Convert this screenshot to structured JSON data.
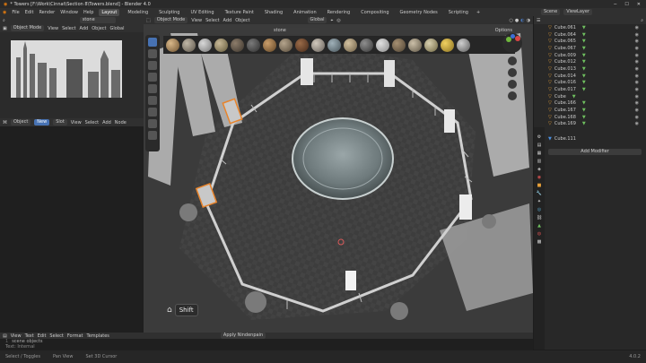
{
  "window": {
    "title": "* Towers [F:\\Work\\Cinnat\\Section 8\\Towers.blend] - Blender 4.0"
  },
  "menu": [
    "File",
    "Edit",
    "Render",
    "Window",
    "Help"
  ],
  "workspaces": [
    "Layout",
    "Modeling",
    "Sculpting",
    "UV Editing",
    "Texture Paint",
    "Shading",
    "Animation",
    "Rendering",
    "Compositing",
    "Geometry Nodes",
    "Scripting"
  ],
  "topright": {
    "scene": "Scene",
    "viewlayer": "ViewLayer"
  },
  "image_editor": {
    "mode": "Object Mode",
    "view": "View",
    "select": "Select",
    "add": "Add",
    "object": "Object",
    "orientation": "Global",
    "search": "stone"
  },
  "node_editor": {
    "object": "Object",
    "view": "View",
    "select": "Select",
    "add": "Add",
    "node": "Node",
    "new": "New",
    "slot": "Slot"
  },
  "viewport": {
    "mode": "Object Mode",
    "view": "View",
    "select": "Select",
    "add": "Add",
    "object": "Object",
    "orientation": "Global",
    "options": "Options",
    "search": "stone",
    "shift_label": "Shift"
  },
  "outliner": {
    "items": [
      "Cube.061",
      "Cube.064",
      "Cube.065",
      "Cube.067",
      "Cube.009",
      "Cube.012",
      "Cube.013",
      "Cube.014",
      "Cube.016",
      "Cube.017",
      "Cube",
      "Cube.166",
      "Cube.167",
      "Cube.168",
      "Cube.169"
    ]
  },
  "properties": {
    "object_name": "Cube.111",
    "add_modifier": "Add Modifier"
  },
  "text_editor": {
    "menu": [
      "View",
      "Text",
      "Edit",
      "Select",
      "Format",
      "Templates"
    ],
    "line": "scene objects",
    "status": "Text: Internal",
    "apply_label": "Apply Nindenpain"
  },
  "statusbar": [
    "Select / Toggles",
    "Pan View",
    "Set 3D Cursor"
  ],
  "version": "4.0.2",
  "colors": {
    "accent": "#4772b3",
    "selection": "#e8842c",
    "object_icon": "#e8a038"
  }
}
